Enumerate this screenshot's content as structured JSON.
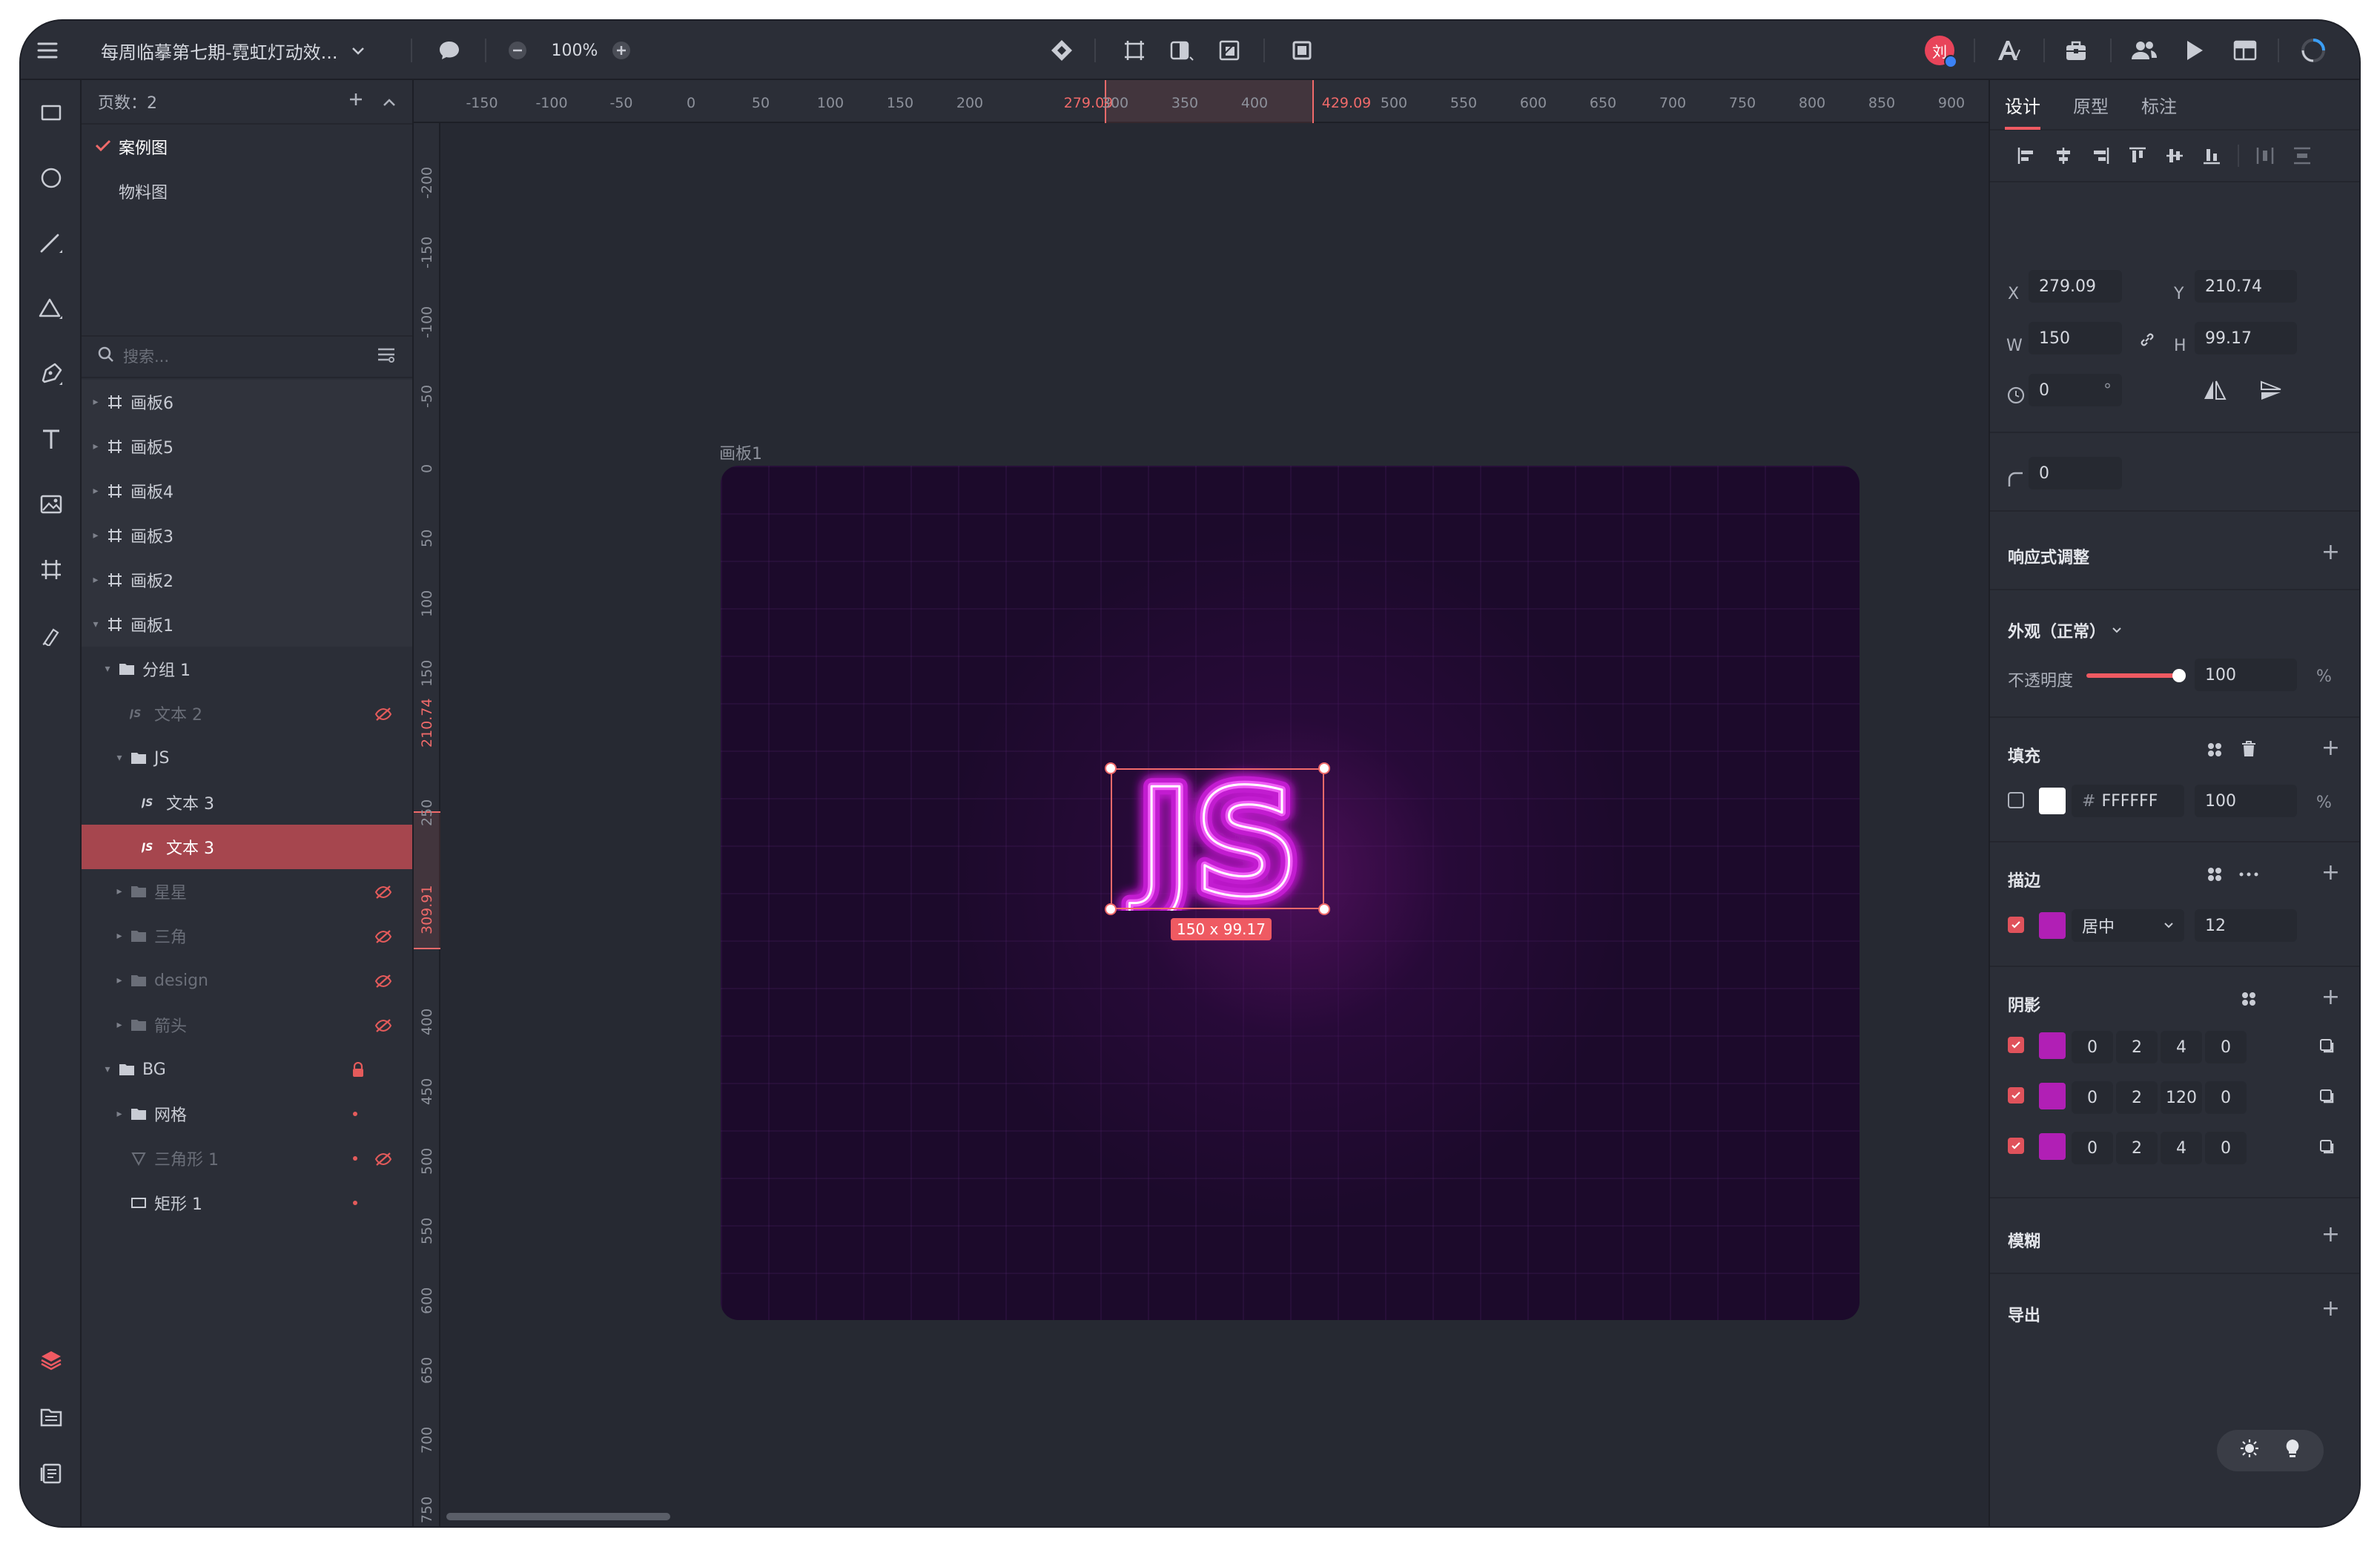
{
  "topbar": {
    "doc_title": "每周临摹第七期-霓虹灯动效...",
    "zoom": "100%",
    "avatar_initial": "刘"
  },
  "layers_panel": {
    "pages_label": "页数：2",
    "pages": [
      {
        "label": "案例图",
        "selected": true
      },
      {
        "label": "物料图",
        "selected": false
      }
    ],
    "search_placeholder": "搜索...",
    "layers": [
      {
        "label": "画板6",
        "icon": "artboard-icon",
        "level": 0,
        "caret": "right"
      },
      {
        "label": "画板5",
        "icon": "artboard-icon",
        "level": 0,
        "caret": "right"
      },
      {
        "label": "画板4",
        "icon": "artboard-icon",
        "level": 0,
        "caret": "right"
      },
      {
        "label": "画板3",
        "icon": "artboard-icon",
        "level": 0,
        "caret": "right"
      },
      {
        "label": "画板2",
        "icon": "artboard-icon",
        "level": 0,
        "caret": "right"
      },
      {
        "label": "画板1",
        "icon": "artboard-icon",
        "level": 0,
        "caret": "down"
      },
      {
        "label": "分组 1",
        "icon": "folder-icon",
        "level": 1,
        "caret": "down"
      },
      {
        "label": "文本 2",
        "icon": "text-layer-icon",
        "level": 2,
        "caret": "",
        "hidden": true
      },
      {
        "label": "JS",
        "icon": "folder-icon",
        "level": 2,
        "caret": "down"
      },
      {
        "label": "文本 3",
        "icon": "text-layer-icon",
        "level": 3,
        "caret": ""
      },
      {
        "label": "文本 3",
        "icon": "text-layer-icon",
        "level": 3,
        "caret": "",
        "selected": true
      },
      {
        "label": "星星",
        "icon": "folder-icon",
        "level": 2,
        "caret": "right",
        "hidden": true
      },
      {
        "label": "三角",
        "icon": "folder-icon",
        "level": 2,
        "caret": "right",
        "hidden": true
      },
      {
        "label": "design",
        "icon": "folder-icon",
        "level": 2,
        "caret": "right",
        "hidden": true
      },
      {
        "label": "箭头",
        "icon": "folder-icon",
        "level": 2,
        "caret": "right",
        "hidden": true
      },
      {
        "label": "BG",
        "icon": "folder-icon",
        "level": 1,
        "caret": "down",
        "locked": true
      },
      {
        "label": "网格",
        "icon": "folder-icon",
        "level": 2,
        "caret": "right",
        "dot": true
      },
      {
        "label": "三角形 1",
        "icon": "triangle-layer-icon",
        "level": 2,
        "caret": "",
        "dot": true,
        "hidden": true
      },
      {
        "label": "矩形 1",
        "icon": "rectangle-layer-icon",
        "level": 2,
        "caret": "",
        "dot": true
      }
    ]
  },
  "canvas": {
    "artboard_label": "画板1",
    "selection_size": "150 x 99.17",
    "neon_text": "JS",
    "ruler_h": [
      "-150",
      "-100",
      "-50",
      "0",
      "50",
      "100",
      "150",
      "200",
      "279.09",
      "300",
      "350",
      "400",
      "429.09",
      "500",
      "550",
      "600",
      "650",
      "700",
      "750",
      "800",
      "850",
      "900"
    ],
    "ruler_v": [
      "-200",
      "-150",
      "-100",
      "-50",
      "0",
      "50",
      "100",
      "150",
      "210.74",
      "250",
      "309.91",
      "400",
      "450",
      "500",
      "550",
      "600",
      "650",
      "700",
      "750"
    ]
  },
  "inspector": {
    "tabs": [
      "设计",
      "原型",
      "标注"
    ],
    "x_label": "X",
    "x": "279.09",
    "y_label": "Y",
    "y": "210.74",
    "w_label": "W",
    "w": "150",
    "h_label": "H",
    "h": "99.17",
    "rotation": "0",
    "rotation_unit": "°",
    "radius": "0",
    "responsive_title": "响应式调整",
    "appearance_title": "外观（正常）",
    "opacity_label": "不透明度",
    "opacity": "100",
    "opacity_unit": "%",
    "opacity_fraction": 1.0,
    "fill_title": "填充",
    "fill": {
      "hash": "#",
      "hex": "FFFFFF",
      "opacity": "100",
      "unit": "%",
      "color": "#FFFFFF"
    },
    "stroke_title": "描边",
    "stroke": {
      "color": "#B11FB5",
      "position": "居中",
      "width": "12"
    },
    "shadow_title": "阴影",
    "shadows": [
      {
        "color": "#B11FB5",
        "x": "0",
        "y": "2",
        "blur": "4",
        "spread": "0"
      },
      {
        "color": "#B11FB5",
        "x": "0",
        "y": "2",
        "blur": "120",
        "spread": "0"
      },
      {
        "color": "#B11FB5",
        "x": "0",
        "y": "2",
        "blur": "4",
        "spread": "0"
      }
    ],
    "blur_title": "模糊",
    "export_title": "导出"
  },
  "colors": {
    "accent": "#EF5A62",
    "neon_magenta": "#E040F0",
    "artboard_bg": "#1C0A2B"
  }
}
